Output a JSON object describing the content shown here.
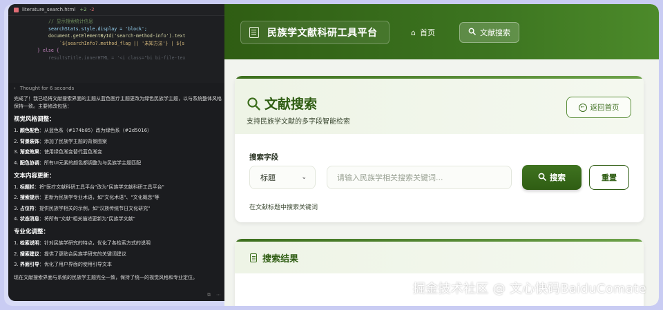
{
  "editor": {
    "file_name": "literature_search.html",
    "diff": "+2",
    "diff_removed": "-2",
    "code_lines": [
      {
        "text": "// 显示搜索统计信息",
        "cls": "c-com",
        "indent": 48
      },
      {
        "text": "searchStats.style.display = 'block';",
        "cls": "c-var",
        "indent": 48
      },
      {
        "text": "document.getElementById('search-method-info').text",
        "cls": "c-fn",
        "indent": 48
      },
      {
        "text": "`${searchInfo?.method_flag || '未知方法'} | ${s",
        "cls": "c-str",
        "indent": 64
      },
      {
        "text": "} else {",
        "cls": "c-kw",
        "indent": 32
      },
      {
        "text": "resultsTitle.innerHTML = '<i class=\"bi bi-file-tex",
        "cls": "c-dim",
        "indent": 48
      }
    ],
    "thought": "Thought for 6 seconds",
    "intro": "完成了！我已经将文献搜索界面的主题从蓝色医疗主题更改为绿色民族学主题，以与系统整体风格保持一致。主要修改包括：",
    "sections": [
      {
        "heading": "视觉风格调整：",
        "items": [
          {
            "bold": "颜色配色",
            "text": "：从蓝色系（#174b85）改为绿色系（#2d5016）"
          },
          {
            "bold": "背景装饰",
            "text": "：添加了民族学主题的背景图案"
          },
          {
            "bold": "渐变效果",
            "text": "：使用绿色渐变替代蓝色渐变"
          },
          {
            "bold": "配色协调",
            "text": "：所有UI元素的颜色都调整为与民族学主题匹配"
          }
        ]
      },
      {
        "heading": "文本内容更新：",
        "items": [
          {
            "bold": "标题栏",
            "text": "：将\"医疗文献科研工具平台\"改为\"民族学文献科研工具平台\""
          },
          {
            "bold": "搜索提示",
            "text": "：更新为民族学专业术语，如\"文化术语\"、\"文化概念\"等"
          },
          {
            "bold": "占位符",
            "text": "：提供民族学相关的示例，如\"汉族传统节日文化研究\""
          },
          {
            "bold": "状态消息",
            "text": "：将所有\"文献\"相关描述更新为\"民族学文献\""
          }
        ]
      },
      {
        "heading": "专业化调整：",
        "items": [
          {
            "bold": "检索说明",
            "text": "：针对民族学研究的特点，优化了各检索方式的说明"
          },
          {
            "bold": "搜索建议",
            "text": "：提供了更贴合民族学研究的关键词建议"
          },
          {
            "bold": "界面引导",
            "text": "：优化了用户界面的使用引导文本"
          }
        ]
      }
    ],
    "outro": "现在文献搜索界面与系统的民族学主题完全一致，保持了统一的视觉风格和专业定位。"
  },
  "app": {
    "brand": "民族学文献科研工具平台",
    "nav": {
      "home": "首页",
      "search": "文献搜索"
    },
    "page_title": "文献搜索",
    "subtitle": "支持民族学文献的多字段智能检索",
    "back_button": "返回首页",
    "field_label": "搜索字段",
    "select_value": "标题",
    "search_placeholder": "请输入民族学相关搜索关键词...",
    "search_button": "搜索",
    "reset_button": "重置",
    "hint": "在文献标题中搜索关键词",
    "results_title": "搜索结果"
  },
  "watermark": "掘金技术社区 @ 文心快码BaiduComate",
  "colors": {
    "primary": "#2d5016",
    "accent": "#3d6f1e",
    "editor_bg": "#1b1c1f",
    "frame": "#c9ccf3"
  }
}
